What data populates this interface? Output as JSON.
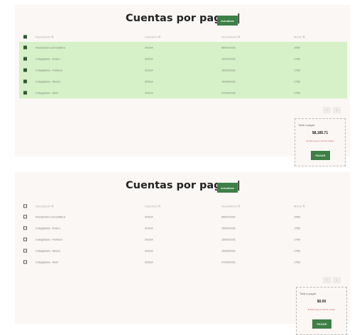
{
  "panels": [
    {
      "title": "Cuentas por pagar |",
      "update_label": "Actualizar",
      "select_all": true,
      "headers": [
        "Descripción ⇅",
        "Cobertura ⇅",
        "Vencimiento ⇅",
        "Monto ⇅"
      ],
      "rows": [
        {
          "selected": true,
          "description": "Inscripción Licenciatura",
          "coverage": "2021A",
          "due": "08/01/2021",
          "amount": "1950"
        },
        {
          "selected": true,
          "description": "Colegiatura - Enero",
          "coverage": "2021A",
          "due": "15/01/2021",
          "amount": "1750"
        },
        {
          "selected": true,
          "description": "Colegiatura - Febrero",
          "coverage": "2021A",
          "due": "15/02/2021",
          "amount": "1750"
        },
        {
          "selected": true,
          "description": "Colegiatura - Marzo",
          "coverage": "2021A",
          "due": "15/03/2021",
          "amount": "1750"
        },
        {
          "selected": true,
          "description": "Colegiatura - Abril",
          "coverage": "2021A",
          "due": "07/04/2021",
          "amount": "1750"
        }
      ],
      "pager": {
        "prev": "‹",
        "next": "›"
      },
      "total": {
        "label": "Total a pagar:",
        "amount": "$8,185.71",
        "note": "El total incluye el 10% de recargo",
        "pay_label": "PAGAR"
      }
    },
    {
      "title": "Cuentas por pagar |",
      "update_label": "Actualizar",
      "select_all": false,
      "headers": [
        "Descripción ⇅",
        "Cobertura ⇅",
        "Vencimiento ⇅",
        "Monto ⇅"
      ],
      "rows": [
        {
          "selected": false,
          "description": "Inscripción Licenciatura",
          "coverage": "2021A",
          "due": "08/01/2021",
          "amount": "1950"
        },
        {
          "selected": false,
          "description": "Colegiatura - Enero",
          "coverage": "2021A",
          "due": "15/01/2021",
          "amount": "1750"
        },
        {
          "selected": false,
          "description": "Colegiatura - Febrero",
          "coverage": "2021A",
          "due": "15/02/2021",
          "amount": "1750"
        },
        {
          "selected": false,
          "description": "Colegiatura - Marzo",
          "coverage": "2021A",
          "due": "15/03/2021",
          "amount": "1750"
        },
        {
          "selected": false,
          "description": "Colegiatura - Abril",
          "coverage": "2021A",
          "due": "07/04/2021",
          "amount": "1750"
        }
      ],
      "pager": {
        "prev": "‹",
        "next": "›"
      },
      "total": {
        "label": "Total a pagar:",
        "amount": "$0.00",
        "note": "El total incluye el 10% de recargo",
        "pay_label": "PAGAR"
      }
    }
  ],
  "colors": {
    "accent_green": "#3d7f45",
    "selected_row": "#d6f1c8",
    "checkbox_checked": "#2e5a32",
    "note_red": "#d25b5b",
    "panel_bg": "#faf7f5"
  },
  "icons": {
    "sort": "sort-icon",
    "prev": "chevron-left-icon",
    "next": "chevron-right-icon"
  }
}
